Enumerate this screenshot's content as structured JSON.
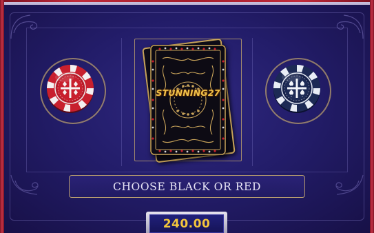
{
  "game": {
    "card_brand": "STUNNING27",
    "prompt": "CHOOSE BLACK OR RED",
    "amount": "240.00"
  },
  "chips": {
    "red": {
      "suit_icon": "diamond-suit-icon",
      "color": "#c8202e"
    },
    "black": {
      "suit_icon": "spade-suit-icon",
      "color": "#1d2a55"
    }
  },
  "colors": {
    "background": "#231d6a",
    "gold": "#c9a45a",
    "amount_text": "#f4c63c"
  }
}
